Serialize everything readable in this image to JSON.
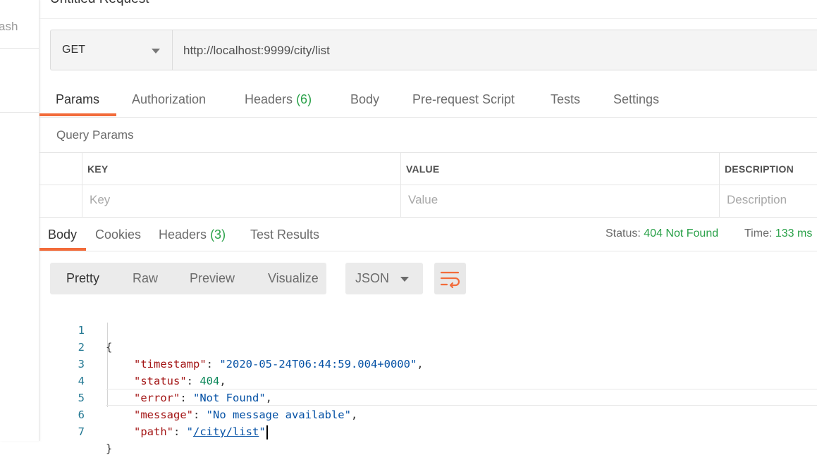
{
  "sidebar": {
    "partial_label": "ash"
  },
  "request": {
    "title": "Untitled Request",
    "method": "GET",
    "url": "http://localhost:9999/city/list"
  },
  "request_tabs": [
    {
      "label": "Params",
      "active": true
    },
    {
      "label": "Authorization"
    },
    {
      "label": "Headers",
      "count": "(6)"
    },
    {
      "label": "Body"
    },
    {
      "label": "Pre-request Script"
    },
    {
      "label": "Tests"
    },
    {
      "label": "Settings"
    }
  ],
  "params": {
    "section_label": "Query Params",
    "headers": [
      "KEY",
      "VALUE",
      "DESCRIPTION"
    ],
    "placeholders": [
      "Key",
      "Value",
      "Description"
    ]
  },
  "response_tabs": [
    {
      "label": "Body",
      "active": true
    },
    {
      "label": "Cookies"
    },
    {
      "label": "Headers",
      "count": "(3)"
    },
    {
      "label": "Test Results"
    }
  ],
  "status": {
    "status_label": "Status:",
    "status_value": "404 Not Found",
    "time_label": "Time:",
    "time_value": "133 ms"
  },
  "view": {
    "modes": [
      "Pretty",
      "Raw",
      "Preview",
      "Visualize"
    ],
    "active_mode": "Pretty",
    "format": "JSON",
    "wrap_icon": "wrap-lines-icon"
  },
  "code": {
    "line_numbers": [
      "1",
      "2",
      "3",
      "4",
      "5",
      "6",
      "7"
    ],
    "open_brace": "{",
    "close_brace": "}",
    "fields": [
      {
        "key": "\"timestamp\"",
        "value": "\"2020-05-24T06:44:59.004+0000\"",
        "type": "string",
        "comma": ","
      },
      {
        "key": "\"status\"",
        "value": "404",
        "type": "number",
        "comma": ","
      },
      {
        "key": "\"error\"",
        "value": "\"Not Found\"",
        "type": "string",
        "comma": ","
      },
      {
        "key": "\"message\"",
        "value": "\"No message available\"",
        "type": "string",
        "comma": ","
      },
      {
        "key": "\"path\"",
        "value_prefix": "\"",
        "value_link": "/city/list",
        "value_suffix": "\"",
        "type": "link",
        "comma": ""
      }
    ]
  },
  "colors": {
    "accent": "#f26b3a",
    "success": "#2aa149",
    "json_key": "#a31515",
    "json_string": "#0451a5",
    "json_number": "#098658",
    "line_number": "#237893"
  }
}
